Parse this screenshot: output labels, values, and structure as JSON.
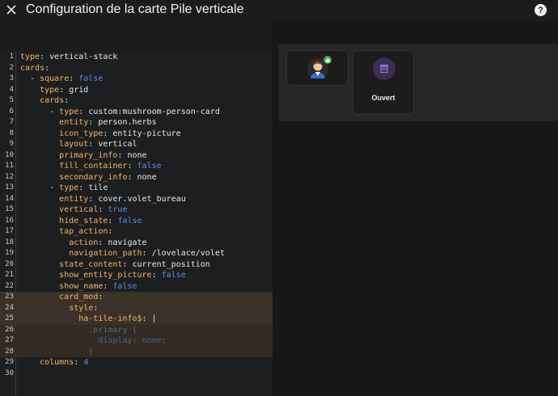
{
  "header": {
    "title": "Configuration de la carte Pile verticale",
    "close_icon": "close-icon",
    "help_icon": "help-icon",
    "help_label": "?"
  },
  "editor": {
    "lines": [
      {
        "n": "1",
        "key": "type",
        "value": "vertical-stack",
        "indent": 0
      },
      {
        "n": "2",
        "key": "cards",
        "value": "",
        "indent": 0
      },
      {
        "n": "3",
        "key": "- square",
        "value": "false",
        "indent": 1
      },
      {
        "n": "4",
        "key": "type",
        "value": "grid",
        "indent": 2
      },
      {
        "n": "5",
        "key": "cards",
        "value": "",
        "indent": 2
      },
      {
        "n": "6",
        "key": "- type",
        "value": "custom:mushroom-person-card",
        "indent": 3
      },
      {
        "n": "7",
        "key": "entity",
        "value": "person.herbs",
        "indent": 4
      },
      {
        "n": "8",
        "key": "icon_type",
        "value": "entity-picture",
        "indent": 4
      },
      {
        "n": "9",
        "key": "layout",
        "value": "vertical",
        "indent": 4
      },
      {
        "n": "10",
        "key": "primary_info",
        "value": "none",
        "indent": 4
      },
      {
        "n": "11",
        "key": "fill_container",
        "value": "false",
        "indent": 4
      },
      {
        "n": "12",
        "key": "secondary_info",
        "value": "none",
        "indent": 4
      },
      {
        "n": "13",
        "key": "- type",
        "value": "tile",
        "indent": 3
      },
      {
        "n": "14",
        "key": "entity",
        "value": "cover.volet_bureau",
        "indent": 4
      },
      {
        "n": "15",
        "key": "vertical",
        "value": "true",
        "indent": 4
      },
      {
        "n": "16",
        "key": "hide_state",
        "value": "false",
        "indent": 4
      },
      {
        "n": "17",
        "key": "tap_action",
        "value": "",
        "indent": 4
      },
      {
        "n": "18",
        "key": "action",
        "value": "navigate",
        "indent": 5
      },
      {
        "n": "19",
        "key": "navigation_path",
        "value": "/lovelace/volet",
        "indent": 5
      },
      {
        "n": "20",
        "key": "state_content",
        "value": "current_position",
        "indent": 4
      },
      {
        "n": "21",
        "key": "show_entity_picture",
        "value": "false",
        "indent": 4
      },
      {
        "n": "22",
        "key": "show_name",
        "value": "false",
        "indent": 4
      },
      {
        "n": "23",
        "key": "card_mod",
        "value": "",
        "indent": 4
      },
      {
        "n": "24",
        "key": "style",
        "value": "",
        "indent": 5
      },
      {
        "n": "25",
        "key": "ha-tile-info$",
        "value": "|",
        "indent": 6
      },
      {
        "n": "26",
        "key": "",
        "value": ".primary {",
        "indent": 7
      },
      {
        "n": "27",
        "key": "",
        "value": "display: none;",
        "indent": 8
      },
      {
        "n": "28",
        "key": "",
        "value": "}",
        "indent": 7
      },
      {
        "n": "29",
        "key": "columns",
        "value": "4",
        "indent": 2
      },
      {
        "n": "30",
        "key": "",
        "value": "",
        "indent": 0
      }
    ],
    "highlighted_lines": [
      "23",
      "24",
      "25",
      "26",
      "27",
      "28"
    ]
  },
  "preview": {
    "person_card_icon": "person-avatar-icon",
    "tile_icon": "window-shade-icon",
    "tile_label": "Ouvert"
  },
  "colors": {
    "key": "#f3b66a",
    "boolean": "#5b8fe0",
    "css": "#3d6e88",
    "highlight": "#3a3228",
    "badge": "#3fae4f",
    "shade": "#7d5fc9"
  }
}
